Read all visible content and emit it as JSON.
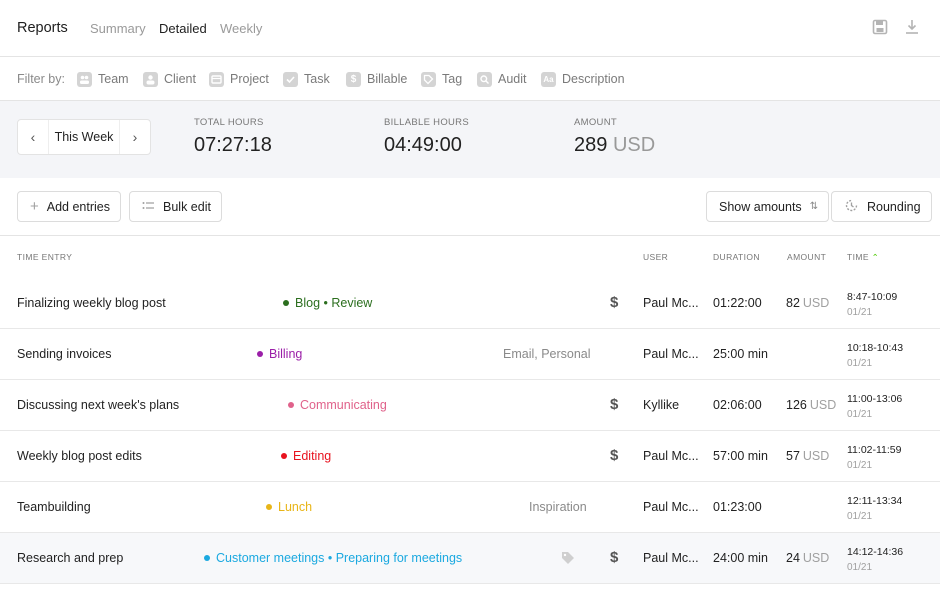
{
  "header": {
    "title": "Reports",
    "tabs": [
      "Summary",
      "Detailed",
      "Weekly"
    ],
    "active_tab": "Detailed",
    "save_icon": "save-icon",
    "download_icon": "download-icon"
  },
  "filters": {
    "label": "Filter by:",
    "items": [
      {
        "label": "Team",
        "icon": "team-icon"
      },
      {
        "label": "Client",
        "icon": "client-icon"
      },
      {
        "label": "Project",
        "icon": "project-icon"
      },
      {
        "label": "Task",
        "icon": "task-icon"
      },
      {
        "label": "Billable",
        "icon": "billable-icon"
      },
      {
        "label": "Tag",
        "icon": "tag-icon"
      },
      {
        "label": "Audit",
        "icon": "audit-icon"
      },
      {
        "label": "Description",
        "icon": "description-icon"
      }
    ]
  },
  "summary": {
    "period": "This Week",
    "total_hours_label": "TOTAL HOURS",
    "total_hours": "07:27:18",
    "billable_hours_label": "BILLABLE HOURS",
    "billable_hours": "04:49:00",
    "amount_label": "AMOUNT",
    "amount_value": "289",
    "amount_unit": "USD"
  },
  "actions": {
    "add_entries": "Add entries",
    "bulk_edit": "Bulk edit",
    "show_amounts": "Show amounts",
    "rounding": "Rounding"
  },
  "table": {
    "columns": {
      "time_entry": "TIME ENTRY",
      "user": "USER",
      "duration": "DURATION",
      "amount": "AMOUNT",
      "time": "TIME"
    },
    "rows": [
      {
        "description": "Finalizing weekly blog post",
        "project": "Blog • Review",
        "project_color": "#2b6e1e",
        "tags": "",
        "billable": "$",
        "user": "Paul Mc...",
        "duration": "01:22:00",
        "amount": "82",
        "amount_unit": "USD",
        "time_range": "8:47-10:09",
        "date": "01/21"
      },
      {
        "description": "Sending invoices",
        "project": "Billing",
        "project_color": "#9b1fa8",
        "tags": "Email, Personal",
        "billable": "",
        "user": "Paul Mc...",
        "duration": "25:00 min",
        "amount": "",
        "amount_unit": "",
        "time_range": "10:18-10:43",
        "date": "01/21"
      },
      {
        "description": "Discussing next week's plans",
        "project": "Communicating",
        "project_color": "#e0628b",
        "tags": "",
        "billable": "$",
        "user": "Kyllike",
        "duration": "02:06:00",
        "amount": "126",
        "amount_unit": "USD",
        "time_range": "11:00-13:06",
        "date": "01/21"
      },
      {
        "description": "Weekly blog post edits",
        "project": "Editing",
        "project_color": "#e8131f",
        "tags": "",
        "billable": "$",
        "user": "Paul Mc...",
        "duration": "57:00 min",
        "amount": "57",
        "amount_unit": "USD",
        "time_range": "11:02-11:59",
        "date": "01/21"
      },
      {
        "description": "Teambuilding",
        "project": "Lunch",
        "project_color": "#e8b518",
        "tags": "Inspiration",
        "billable": "",
        "user": "Paul Mc...",
        "duration": "01:23:00",
        "amount": "",
        "amount_unit": "",
        "time_range": "12:11-13:34",
        "date": "01/21"
      },
      {
        "description": "Research and prep",
        "project": "Customer meetings • Preparing for meetings",
        "project_color": "#1ba9e0",
        "tags": "",
        "billable": "$",
        "user": "Paul Mc...",
        "duration": "24:00 min",
        "amount": "24",
        "amount_unit": "USD",
        "time_range": "14:12-14:36",
        "date": "01/21"
      }
    ]
  }
}
